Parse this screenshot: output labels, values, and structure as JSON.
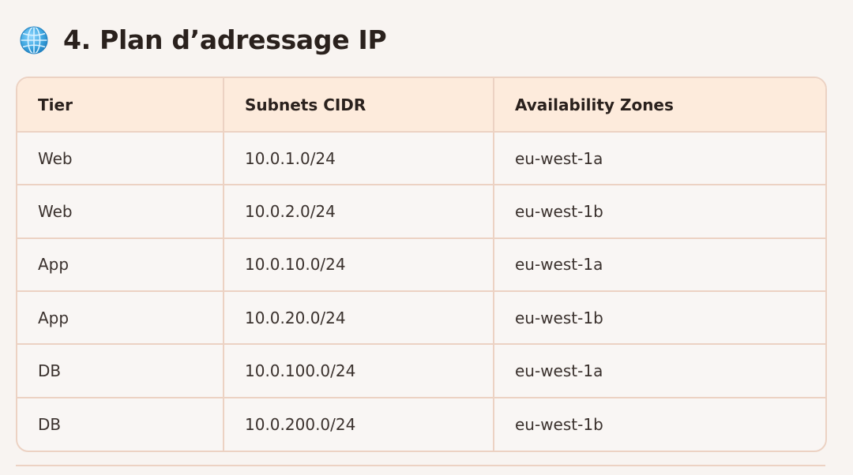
{
  "section": {
    "icon": "globe-icon",
    "title": "4. Plan d’adressage IP"
  },
  "table": {
    "headers": [
      "Tier",
      "Subnets CIDR",
      "Availability Zones"
    ],
    "rows": [
      [
        "Web",
        "10.0.1.0/24",
        "eu-west-1a"
      ],
      [
        "Web",
        "10.0.2.0/24",
        "eu-west-1b"
      ],
      [
        "App",
        "10.0.10.0/24",
        "eu-west-1a"
      ],
      [
        "App",
        "10.0.20.0/24",
        "eu-west-1b"
      ],
      [
        "DB",
        "10.0.100.0/24",
        "eu-west-1a"
      ],
      [
        "DB",
        "10.0.200.0/24",
        "eu-west-1b"
      ]
    ]
  },
  "colors": {
    "background": "#f8f4f1",
    "header_bg": "#fdebdc",
    "border": "#ecd2c3",
    "globe": "#3fa7e0"
  }
}
